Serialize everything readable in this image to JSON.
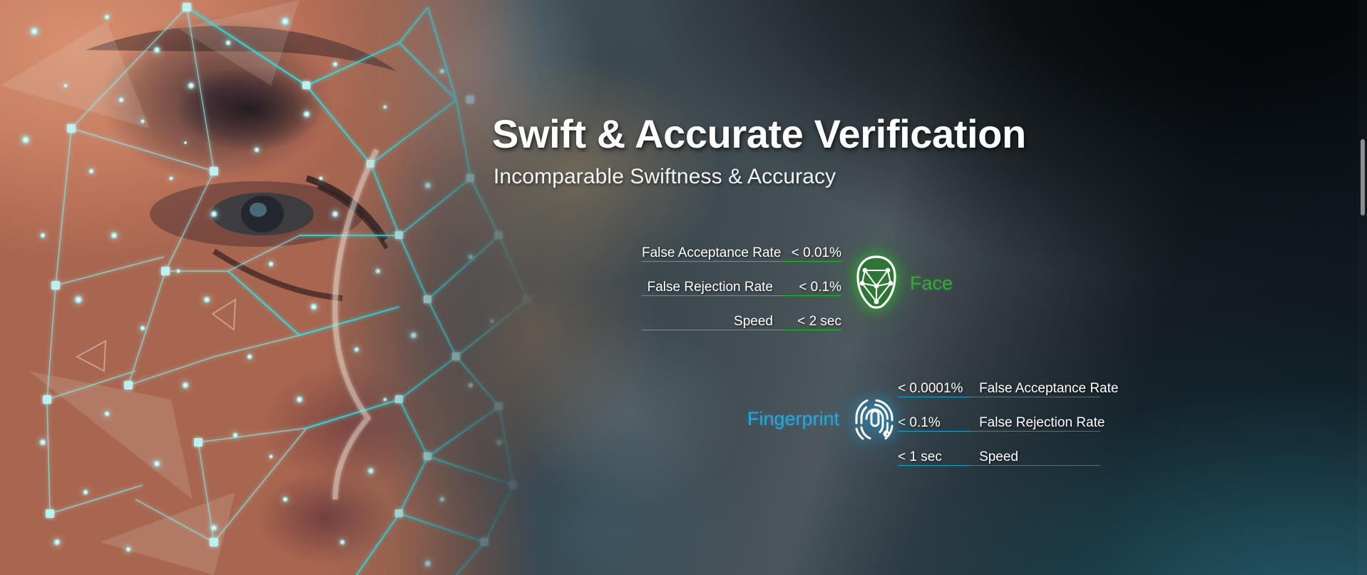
{
  "hero": {
    "title": "Swift & Accurate Verification",
    "subtitle": "Incomparable Swiftness & Accuracy"
  },
  "face": {
    "name": "Face",
    "icon": "face-mesh-icon",
    "accent_color": "#3aa83a",
    "underline_color": "#21c021",
    "rows": [
      {
        "label": "False Acceptance Rate",
        "value": "< 0.01%"
      },
      {
        "label": "False Rejection Rate",
        "value": "< 0.1%"
      },
      {
        "label": "Speed",
        "value": "< 2 sec"
      }
    ]
  },
  "fingerprint": {
    "name": "Fingerprint",
    "icon": "fingerprint-icon",
    "accent_color": "#29a8e0",
    "underline_color": "#1b9fd8",
    "rows": [
      {
        "value": "< 0.0001%",
        "label": "False Acceptance Rate"
      },
      {
        "value": "< 0.1%",
        "label": "False Rejection Rate"
      },
      {
        "value": "< 1 sec",
        "label": "Speed"
      }
    ]
  },
  "background": {
    "photo_alt": "face-profile-biometric-mesh",
    "mesh_color": "#3ee6e6",
    "skin_tone": "#c87f63"
  }
}
